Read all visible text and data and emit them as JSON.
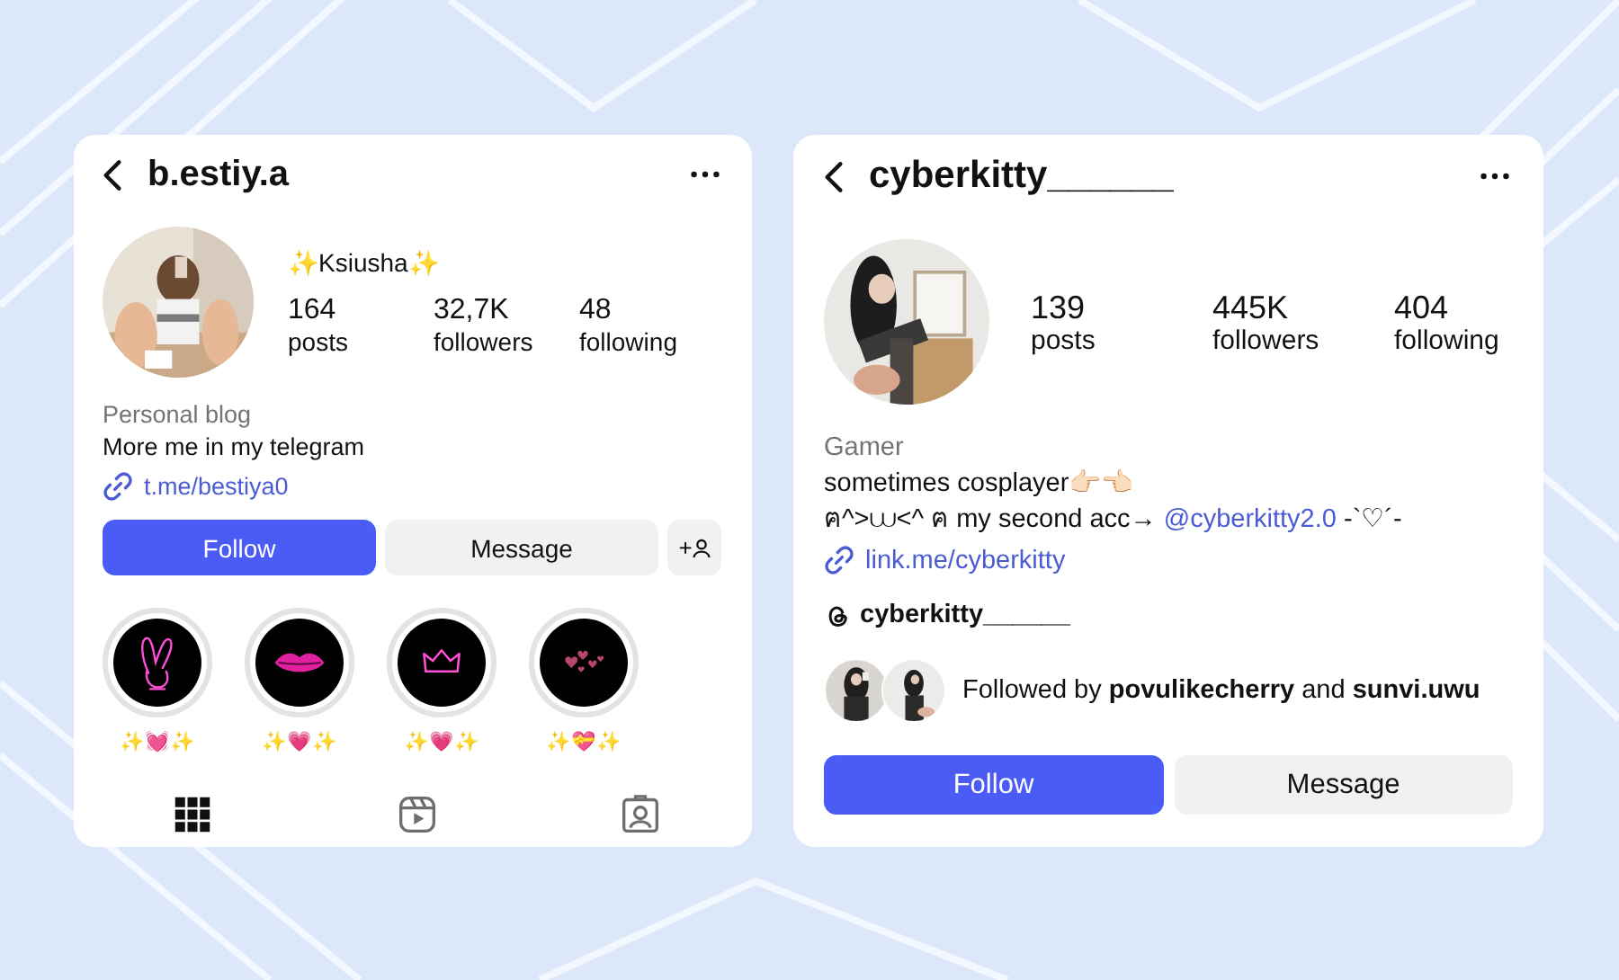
{
  "profiles": [
    {
      "username": "b.estiy.a",
      "display_name": "✨Ksiusha✨",
      "stats": [
        {
          "value": "164",
          "label": "posts"
        },
        {
          "value": "32,7K",
          "label": "followers"
        },
        {
          "value": "48",
          "label": "following"
        }
      ],
      "category": "Personal blog",
      "bio": [
        {
          "text": "More me in my telegram"
        }
      ],
      "link": "t.me/bestiya0",
      "buttons": [
        {
          "kind": "primary",
          "label": "Follow"
        },
        {
          "kind": "secondary",
          "label": "Message"
        },
        {
          "kind": "add-person",
          "label": "+"
        }
      ],
      "highlights": [
        {
          "kind": "bunny",
          "label": "✨💓✨"
        },
        {
          "kind": "lips",
          "label": "✨💗✨"
        },
        {
          "kind": "crown",
          "label": "✨💗✨"
        },
        {
          "kind": "hearts",
          "label": "✨💝✨"
        }
      ],
      "tabs": [
        {
          "kind": "grid",
          "selected": true
        },
        {
          "kind": "reels",
          "selected": false
        },
        {
          "kind": "tagged",
          "selected": false
        }
      ]
    },
    {
      "username": "cyberkitty______",
      "stats": [
        {
          "value": "139",
          "label": "posts"
        },
        {
          "value": "445K",
          "label": "followers"
        },
        {
          "value": "404",
          "label": "following"
        }
      ],
      "category": "Gamer",
      "bio": [
        {
          "text": "sometimes cosplayer👉🏻👈🏻"
        },
        {
          "text": "ฅ^>⩊<^ ฅ  my second acc→",
          "mention": "@cyberkitty2.0",
          "after": "-`♡´-"
        }
      ],
      "link": "link.me/cyberkitty",
      "threads": "cyberkitty______",
      "followed_by": "Followed by **povulikecherry** and **sunvi.uwu**",
      "buttons": [
        {
          "kind": "primary",
          "label": "Follow"
        },
        {
          "kind": "secondary",
          "label": "Message"
        }
      ]
    }
  ]
}
